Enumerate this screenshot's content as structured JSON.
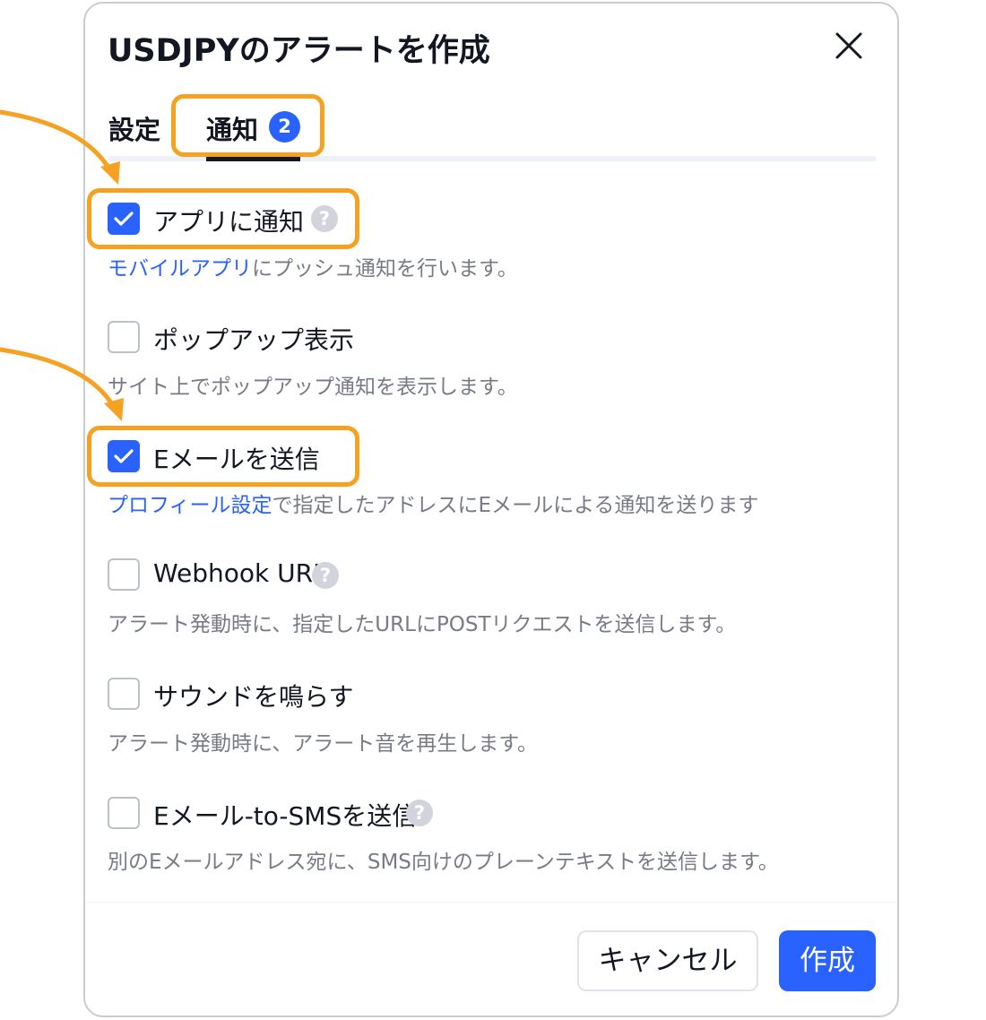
{
  "dialog": {
    "title": "USDJPYのアラートを作成",
    "close_icon": "close-icon"
  },
  "tabs": [
    {
      "label": "設定"
    },
    {
      "label": "通知",
      "badge": "2",
      "active": true
    }
  ],
  "options": [
    {
      "label": "アプリに通知",
      "checked": true,
      "help_icon": "?",
      "desc_link": "モバイルアプリ",
      "desc_rest": "にプッシュ通知を行います。"
    },
    {
      "label": "ポップアップ表示",
      "checked": false,
      "desc": "サイト上でポップアップ通知を表示します。"
    },
    {
      "label": "Eメールを送信",
      "checked": true,
      "desc_link": "プロフィール設定",
      "desc_rest": "で指定したアドレスにEメールによる通知を送ります"
    },
    {
      "label": "Webhook URL",
      "checked": false,
      "help_icon": "?",
      "desc": "アラート発動時に、指定したURLにPOSTリクエストを送信します。"
    },
    {
      "label": "サウンドを鳴らす",
      "checked": false,
      "desc": "アラート発動時に、アラート音を再生します。"
    },
    {
      "label": "Eメール-to-SMSを送信",
      "checked": false,
      "help_icon": "?",
      "desc": "別のEメールアドレス宛に、SMS向けのプレーンテキストを送信します。"
    }
  ],
  "footer": {
    "cancel_label": "キャンセル",
    "create_label": "作成"
  },
  "colors": {
    "accent": "#2962ff",
    "highlight": "#f5a122",
    "muted_text": "#787b86"
  }
}
